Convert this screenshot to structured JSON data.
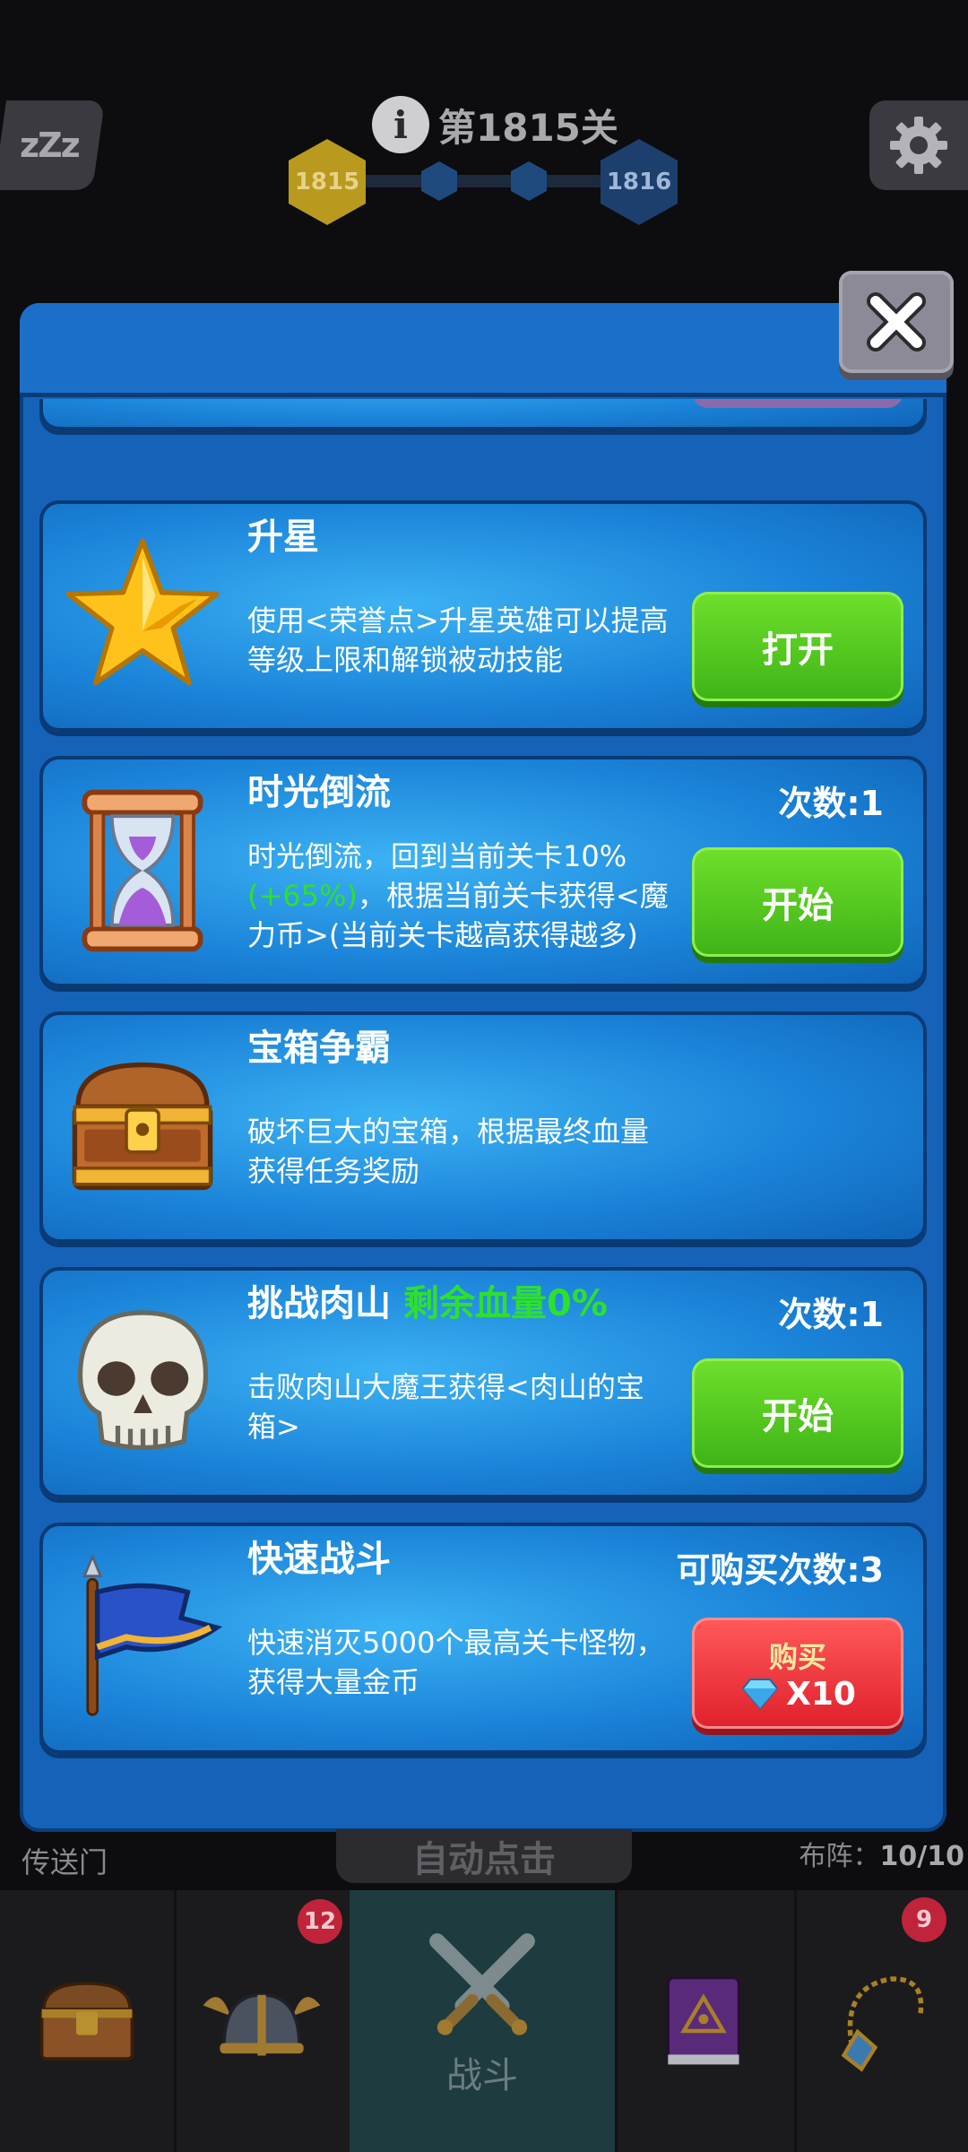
{
  "hud": {
    "sleep_label": "zZz",
    "level_title": "第1815关",
    "current_level": "1815",
    "next_level": "1816"
  },
  "modal": {
    "close_label": "✕",
    "cards": [
      {
        "id": "star",
        "title": "升星",
        "desc": "使用<荣誉点>升星英雄可以提高等级上限和解锁被动技能",
        "button": "打开"
      },
      {
        "id": "time",
        "title": "时光倒流",
        "desc_a": "时光倒流，回到当前关卡10%",
        "desc_green": "(+65%)",
        "desc_b": "，根据当前关卡获得<魔力币>(当前关卡越高获得越多)",
        "count": "次数:1",
        "button": "开始"
      },
      {
        "id": "chest",
        "title": "宝箱争霸",
        "desc": "破坏巨大的宝箱，根据最终血量获得任务奖励"
      },
      {
        "id": "boss",
        "title": "挑战肉山",
        "title_hp": "剩余血量0%",
        "desc": "击败肉山大魔王获得<肉山的宝箱>",
        "count": "次数:1",
        "button": "开始"
      },
      {
        "id": "quick",
        "title": "快速战斗",
        "desc": "快速消灭5000个最高关卡怪物，获得大量金币",
        "count": "可购买次数:3",
        "button_label": "购买",
        "button_price": "X10"
      }
    ]
  },
  "footer": {
    "portal": "传送门",
    "auto_click": "自动点击",
    "formation_label": "布阵：",
    "formation_value": "10/10"
  },
  "tabs": [
    {
      "name": "treasure",
      "icon": "treasure-chest-icon"
    },
    {
      "name": "heroes",
      "icon": "viking-helmet-icon",
      "badge": "12"
    },
    {
      "name": "battle",
      "icon": "crossed-swords-icon",
      "label": "战斗",
      "active": true
    },
    {
      "name": "spellbook",
      "icon": "spellbook-icon"
    },
    {
      "name": "amulet",
      "icon": "amulet-icon",
      "badge": "9"
    }
  ],
  "colors": {
    "modal_blue": "#1563b8",
    "button_green": "#4bc41c",
    "button_red": "#e0202c",
    "highlight_green": "#2ee02e"
  }
}
